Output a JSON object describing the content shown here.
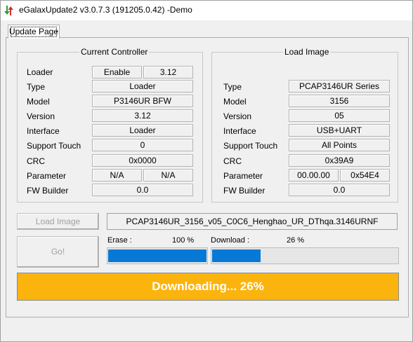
{
  "window": {
    "title": "eGalaxUpdate2 v3.0.7.3 (191205.0.42) -Demo"
  },
  "tabs": [
    {
      "label": "Update Page"
    }
  ],
  "current_controller": {
    "title": "Current Controller",
    "rows": [
      {
        "label": "Loader",
        "values": [
          "Enable",
          "3.12"
        ]
      },
      {
        "label": "Type",
        "values": [
          "Loader"
        ]
      },
      {
        "label": "Model",
        "values": [
          "P3146UR BFW"
        ]
      },
      {
        "label": "Version",
        "values": [
          "3.12"
        ]
      },
      {
        "label": "Interface",
        "values": [
          "Loader"
        ]
      },
      {
        "label": "Support Touch",
        "values": [
          "0"
        ]
      },
      {
        "label": "CRC",
        "values": [
          "0x0000"
        ]
      },
      {
        "label": "Parameter",
        "values": [
          "N/A",
          "N/A"
        ]
      },
      {
        "label": "FW Builder",
        "values": [
          "0.0"
        ]
      }
    ]
  },
  "load_image": {
    "title": "Load Image",
    "rows": [
      {
        "label": "Type",
        "values": [
          "PCAP3146UR Series"
        ]
      },
      {
        "label": "Model",
        "values": [
          "3156"
        ]
      },
      {
        "label": "Version",
        "values": [
          "05"
        ]
      },
      {
        "label": "Interface",
        "values": [
          "USB+UART"
        ]
      },
      {
        "label": "Support Touch",
        "values": [
          "All Points"
        ]
      },
      {
        "label": "CRC",
        "values": [
          "0x39A9"
        ]
      },
      {
        "label": "Parameter",
        "values": [
          "00.00.00",
          "0x54E4"
        ]
      },
      {
        "label": "FW Builder",
        "values": [
          "0.0"
        ]
      }
    ]
  },
  "buttons": {
    "load_image": "Load Image",
    "go": "Go!"
  },
  "file_name": "PCAP3146UR_3156_v05_C0C6_Henghao_UR_DThqa.3146URNF",
  "erase": {
    "label": "Erase :",
    "percent_text": "100 %",
    "value": 100
  },
  "download": {
    "label": "Download :",
    "percent_text": "26 %",
    "value": 26
  },
  "status_banner": "Downloading... 26%",
  "colors": {
    "progress": "#0679d6",
    "banner": "#fbb40e"
  }
}
